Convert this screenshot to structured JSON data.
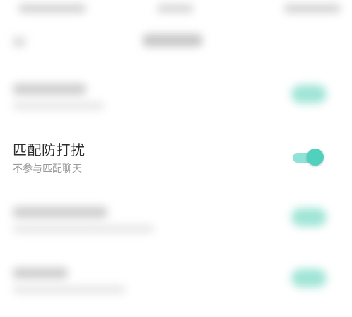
{
  "setting": {
    "title": "匹配防打扰",
    "subtitle": "不参与匹配聊天",
    "enabled": true
  },
  "colors": {
    "accent": "#4fd1bd",
    "accent_track": "#8fe3d6",
    "title_text": "#2b2b2b",
    "subtitle_text": "#9a9a9a"
  }
}
